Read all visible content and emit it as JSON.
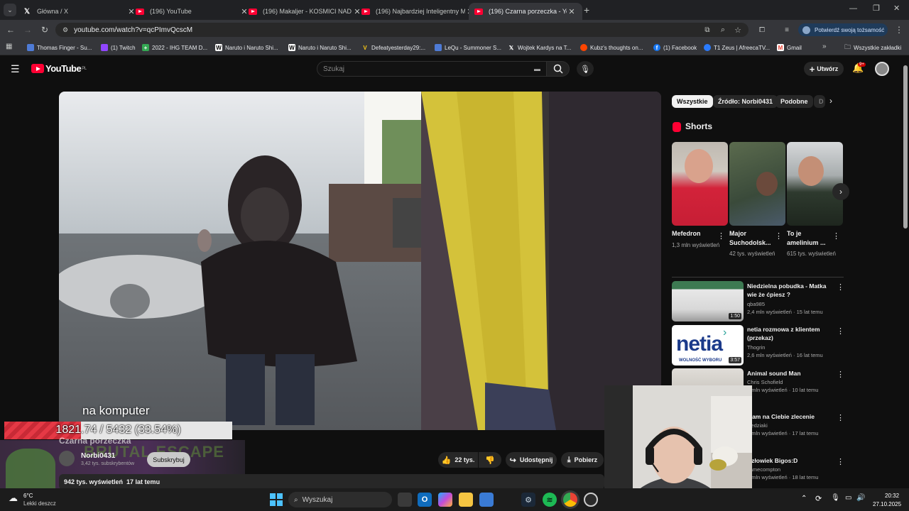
{
  "browser": {
    "tabs": [
      {
        "title": "Główna / X",
        "icon": "x-logo-icon",
        "active": false
      },
      {
        "title": "(196) YouTube",
        "icon": "youtube-icon",
        "active": false
      },
      {
        "title": "(196) Makaljer - KOSMICI NAD",
        "icon": "youtube-icon",
        "active": false
      },
      {
        "title": "(196) Najbardziej Inteligentny M",
        "icon": "youtube-icon",
        "active": false
      },
      {
        "title": "(196) Czarna porzeczka - Yo",
        "icon": "youtube-icon",
        "active": true
      }
    ],
    "url": "youtube.com/watch?v=qcPImvQcscM",
    "profile_label": "Potwierdź swoją tożsamość",
    "bookmarks": [
      "Thomas Finger - Su...",
      "(1) Twitch",
      "2022 - IHG TEAM D...",
      "Naruto i Naruto Shi...",
      "Naruto i Naruto Shi...",
      "Defeatyesterday29:...",
      "LeQu - Summoner S...",
      "Wojtek Kardys na T...",
      "Kubz's thoughts on...",
      "(1) Facebook",
      "T1 Zeus | AfreecaTV...",
      "Gmail"
    ],
    "all_bookmarks": "Wszystkie zakładki"
  },
  "youtube": {
    "logo": "YouTube",
    "region": "PL",
    "search_placeholder": "Szukaj",
    "create": "Utwórz",
    "notifications": "9+",
    "chips": [
      "Wszystkie",
      "Źródło: Norbi0431",
      "Podobne",
      "D"
    ],
    "shorts_heading": "Shorts",
    "shorts": [
      {
        "title": "Mefedron",
        "views": "1,3 mln wyświetleń"
      },
      {
        "title": "Major Suchodolsk...",
        "views": "42 tys. wyświetleń"
      },
      {
        "title": "To je amelinium ...",
        "views": "615 tys. wyświetleń"
      }
    ],
    "recommended": [
      {
        "title": "Niedzielna pobudka - Matka wie że ćpiesz ?",
        "channel": "qba985",
        "meta": "2,4 mln wyświetleń · 15 lat temu",
        "duration": "1:50"
      },
      {
        "title": "netia rozmowa z klientem (przekaz)",
        "channel": "Thogrin",
        "meta": "2,6 mln wyświetleń · 16 lat temu",
        "duration": "3:57",
        "thumb_text": "netia",
        "thumb_sub": "WOLNOŚĆ WYBORU"
      },
      {
        "title": "Animal sound Man",
        "channel": "Chris Schofield",
        "meta": "5 mln wyświetleń · 10 lat temu"
      },
      {
        "title": "Mam na Ciebie zlecenie",
        "channel": "Redziaki",
        "meta": "1 mln wyświetleń · 17 lat temu"
      },
      {
        "title": "Człowiek Bigos:D",
        "channel": "Jamecompton",
        "meta": "1 mln wyświetleń · 18 lat temu"
      }
    ],
    "video": {
      "caption": "na komputer",
      "title": "Czarna porzeczka",
      "channel": "Norbi0431",
      "subscribers": "3,42 tys. subskrybentów",
      "subscribe": "Subskrybuj",
      "likes": "22 tys.",
      "share": "Udostępnij",
      "download": "Pobierz",
      "views_age": "942 tys. wyświetleń  17 lat temu"
    }
  },
  "overlay": {
    "progress_text": "1821.74 / 5432 (33.54%)",
    "progress_fraction": 0.3354,
    "banner": "BRUTAL ESCAPE"
  },
  "taskbar": {
    "weather_temp": "6°C",
    "weather_desc": "Lekki deszcz",
    "search": "Wyszukaj",
    "time": "20:32",
    "date": "27.10.2025"
  },
  "colors": {
    "accent": "#ff0033",
    "progress": "#e53945"
  }
}
